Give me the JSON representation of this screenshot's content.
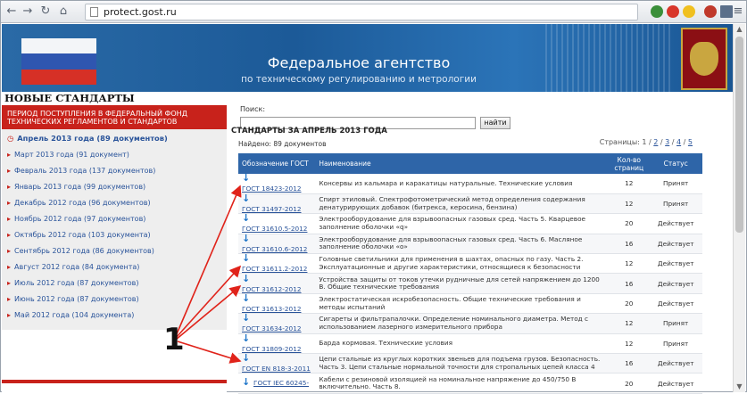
{
  "browser": {
    "url": "protect.gost.ru"
  },
  "header": {
    "title": "Федеральное агентство",
    "subtitle": "по техническому регулированию и метрологии"
  },
  "sidebar": {
    "heading": "НОВЫЕ СТАНДАРТЫ",
    "red_bar": "ПЕРИОД ПОСТУПЛЕНИЯ В ФЕДЕРАЛЬНЫЙ ФОНД ТЕХНИЧЕСКИХ РЕГЛАМЕНТОВ И СТАНДАРТОВ",
    "items": [
      {
        "label": "Апрель 2013 года (89 документов)",
        "active": true
      },
      {
        "label": "Март 2013 года (91 документ)"
      },
      {
        "label": "Февраль 2013 года (137 документов)"
      },
      {
        "label": "Январь 2013 года (99 документов)"
      },
      {
        "label": "Декабрь 2012 года (96 документов)"
      },
      {
        "label": "Ноябрь 2012 года (97 документов)"
      },
      {
        "label": "Октябрь 2012 года (103 документа)"
      },
      {
        "label": "Сентябрь 2012 года (86 документов)"
      },
      {
        "label": "Август 2012 года (84 документа)"
      },
      {
        "label": "Июль 2012 года (87 документов)"
      },
      {
        "label": "Июнь 2012 года (87 документов)"
      },
      {
        "label": "Май 2012 года (104 документа)"
      }
    ]
  },
  "search": {
    "label": "Поиск:",
    "value": "",
    "button": "найти"
  },
  "main": {
    "title": "СТАНДАРТЫ ЗА АПРЕЛЬ 2013 ГОДА",
    "found": "Найдено: 89 документов",
    "pages_label": "Страницы:",
    "pages": [
      "1",
      "2",
      "3",
      "4",
      "5"
    ]
  },
  "table": {
    "headers": {
      "code": "Обозначение ГОСТ",
      "name": "Наименование",
      "pages": "Кол-во страниц",
      "status": "Статус"
    },
    "rows": [
      {
        "code": "ГОСТ 18423-2012",
        "name": "Консервы из кальмара и каракатицы натуральные. Технические условия",
        "pages": "12",
        "status": "Принят"
      },
      {
        "code": "ГОСТ 31497-2012",
        "name": "Спирт этиловый. Спектрофотометрический метод определения содержания денатурирующих добавок (битрекса, керосина, бензина)",
        "pages": "12",
        "status": "Принят"
      },
      {
        "code": "ГОСТ 31610.5-2012",
        "name": "Электрооборудование для взрывоопасных газовых сред. Часть 5. Кварцевое заполнение оболочки «q»",
        "pages": "20",
        "status": "Действует"
      },
      {
        "code": "ГОСТ 31610.6-2012",
        "name": "Электрооборудование для взрывоопасных газовых сред. Часть 6. Масляное заполнение оболочки «o»",
        "pages": "16",
        "status": "Действует"
      },
      {
        "code": "ГОСТ 31611.2-2012",
        "name": "Головные светильники для применения в шахтах, опасных по газу. Часть 2. Эксплуатационные и другие характеристики, относящиеся к безопасности",
        "pages": "12",
        "status": "Действует"
      },
      {
        "code": "ГОСТ 31612-2012",
        "name": "Устройства защиты от токов утечки рудничные для сетей напряжением до 1200 В. Общие технические требования",
        "pages": "16",
        "status": "Действует"
      },
      {
        "code": "ГОСТ 31613-2012",
        "name": "Электростатическая искробезопасность. Общие технические требования и методы испытаний",
        "pages": "20",
        "status": "Действует"
      },
      {
        "code": "ГОСТ 31634-2012",
        "name": "Сигареты и фильтрапалочки. Определение номинального диаметра. Метод с использованием лазерного измерительного прибора",
        "pages": "12",
        "status": "Принят"
      },
      {
        "code": "ГОСТ 31809-2012",
        "name": "Барда кормовая. Технические условия",
        "pages": "12",
        "status": "Принят"
      },
      {
        "code": "ГОСТ EN 818-3-2011",
        "name": "Цепи стальные из круглых коротких звеньев для подъема грузов. Безопасность. Часть 3. Цепи стальные нормальной точности для стропальных цепей класса 4",
        "pages": "16",
        "status": "Действует"
      },
      {
        "code": "ГОСТ IEC 60245-",
        "name": "Кабели с резиновой изоляцией на номинальное напряжение до 450/750 В включительно. Часть 8.",
        "pages": "20",
        "status": "Действует"
      }
    ]
  },
  "annotation": {
    "number": "1"
  },
  "colors": {
    "accent_red": "#c8221b",
    "header_blue": "#2e65a8",
    "link_blue": "#29539a"
  }
}
